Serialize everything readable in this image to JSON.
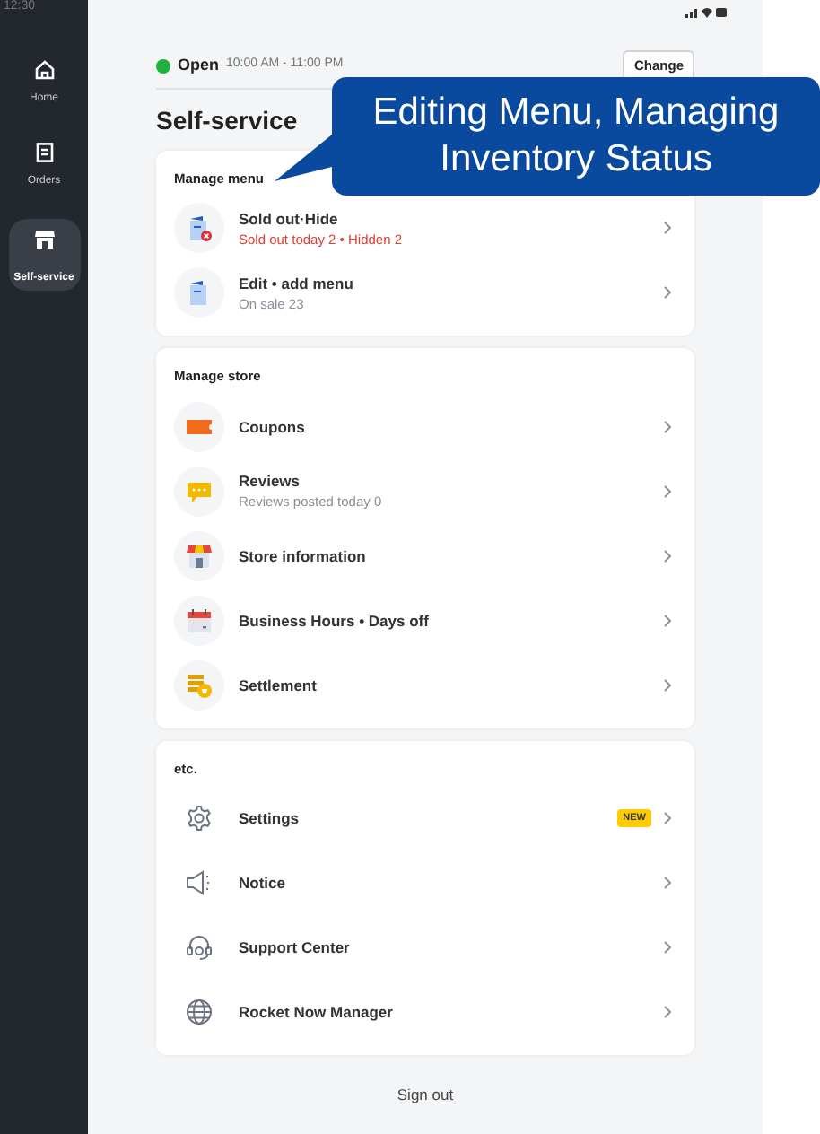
{
  "status_bar": {
    "time": "12:30"
  },
  "sidebar": {
    "items": [
      {
        "label": "Home",
        "selected": false
      },
      {
        "label": "Orders",
        "selected": false
      },
      {
        "label": "Self-service",
        "selected": true
      }
    ]
  },
  "store_status": {
    "open": true,
    "label": "Open",
    "hours": "10:00 AM - 11:00 PM",
    "button": "Change"
  },
  "page_title": "Self-service",
  "callout": {
    "lines": [
      "Editing Menu, Managing",
      "Inventory Status"
    ]
  },
  "sections": [
    {
      "title": "Manage menu",
      "items": [
        {
          "label": "Sold out·Hide",
          "subtitle": "Sold out today 2 • Hidden 2",
          "warning": true
        },
        {
          "label": "Edit • add menu",
          "subtitle": "On sale 23",
          "warning": false
        }
      ]
    },
    {
      "title": "Manage store",
      "items": [
        {
          "label": "Coupons"
        },
        {
          "label": "Reviews",
          "subtitle": "Reviews posted today 0",
          "warning": false
        },
        {
          "label": "Store information"
        },
        {
          "label": "Business Hours • Days off"
        },
        {
          "label": "Settlement"
        }
      ]
    },
    {
      "title": "etc.",
      "items": [
        {
          "label": "Settings",
          "badge": "NEW"
        },
        {
          "label": "Notice"
        },
        {
          "label": "Support Center"
        },
        {
          "label": "Rocket Now Manager"
        }
      ]
    }
  ],
  "sign_out": "Sign out"
}
